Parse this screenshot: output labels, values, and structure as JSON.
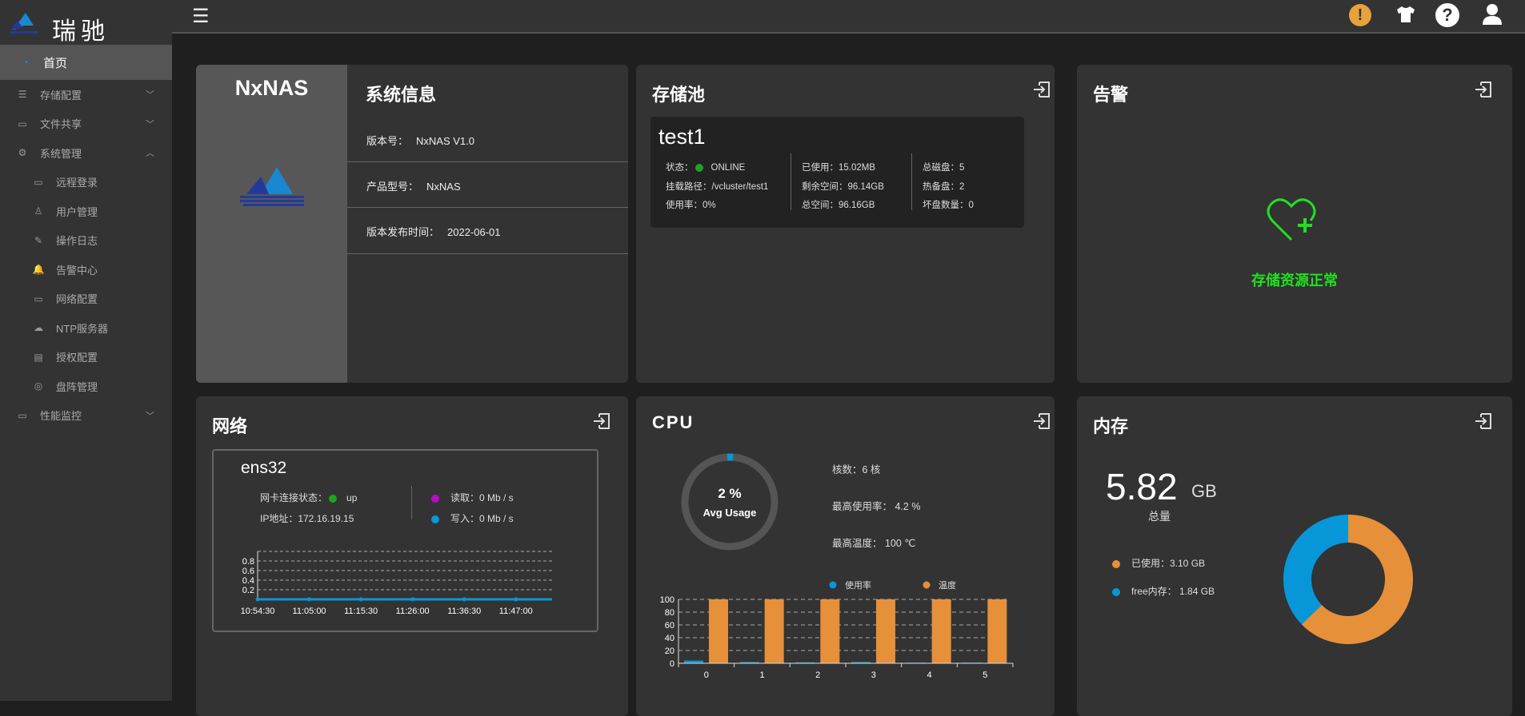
{
  "brand": {
    "name": "瑞驰"
  },
  "sidebar": {
    "items": [
      {
        "label": "首页",
        "icon": "dashboard-icon",
        "active": true
      },
      {
        "label": "存储配置",
        "icon": "server-icon",
        "expand": "down"
      },
      {
        "label": "文件共享",
        "icon": "folder-icon",
        "expand": "down"
      },
      {
        "label": "系统管理",
        "icon": "monitor-gear-icon",
        "expand": "up"
      },
      {
        "label": "远程登录",
        "icon": "monitor-icon",
        "sub": true
      },
      {
        "label": "用户管理",
        "icon": "user-icon",
        "sub": true
      },
      {
        "label": "操作日志",
        "icon": "edit-log-icon",
        "sub": true
      },
      {
        "label": "告警中心",
        "icon": "bell-icon",
        "sub": true
      },
      {
        "label": "网络配置",
        "icon": "network-icon",
        "sub": true
      },
      {
        "label": "NTP服务器",
        "icon": "cloud-icon",
        "sub": true
      },
      {
        "label": "授权配置",
        "icon": "license-icon",
        "sub": true
      },
      {
        "label": "盘阵管理",
        "icon": "disk-icon",
        "sub": true
      },
      {
        "label": "性能监控",
        "icon": "chart-icon",
        "expand": "down"
      }
    ]
  },
  "header": {
    "icons": [
      "alert-icon",
      "tshirt-icon",
      "help-icon",
      "user-icon"
    ]
  },
  "sysinfo": {
    "product": "NxNAS",
    "title": "系统信息",
    "rows": [
      {
        "label": "版本号：",
        "value": "NxNAS V1.0"
      },
      {
        "label": "产品型号：",
        "value": "NxNAS"
      },
      {
        "label": "版本发布时间：",
        "value": "2022-06-01"
      }
    ]
  },
  "pool": {
    "title": "存储池",
    "name": "test1",
    "status_label": "状态：",
    "status": "ONLINE",
    "mount": "挂载路径：/vcluster/test1",
    "usage": "使用率：0%",
    "used": "已使用：15.02MB",
    "free": "剩余空间：96.14GB",
    "total": "总空间：96.16GB",
    "disks": "总磁盘：5",
    "spare": "热备盘：2",
    "bad": "坏盘数量：0"
  },
  "alarm": {
    "title": "告警",
    "message": "存储资源正常"
  },
  "network": {
    "title": "网络",
    "iface": "ens32",
    "link_label": "网卡连接状态：",
    "link": "up",
    "ip": "IP地址：172.16.19.15",
    "read": "读取：0 Mb / s",
    "write": "写入：0 Mb / s"
  },
  "cpu": {
    "title": "CPU",
    "avg": "2 %",
    "avg_label": "Avg Usage",
    "avg_value": 2,
    "cores": "核数：6 核",
    "max_usage": "最高使用率： 4.2 %",
    "max_temp": "最高温度： 100 ℃"
  },
  "memory": {
    "title": "内存",
    "total": "5.82",
    "unit": "GB",
    "total_label": "总量",
    "used": "已使用：3.10 GB",
    "free": "free内存： 1.84 GB"
  },
  "colors": {
    "blue": "#0797d9",
    "orange": "#e6903a",
    "green": "#1fa21f",
    "purple": "#b40fc2",
    "alarm_green": "#21e021"
  },
  "chart_data": [
    {
      "type": "line",
      "title": "network",
      "x": [
        "10:54:30",
        "11:05:00",
        "11:15:30",
        "11:26:00",
        "11:36:30",
        "11:47:00"
      ],
      "yticks": [
        "0.2",
        "0.4",
        "0.6",
        "0.8"
      ],
      "ylim": [
        0,
        1
      ],
      "series": [
        {
          "name": "写入",
          "values": [
            0,
            0,
            0,
            0,
            0,
            0
          ]
        },
        {
          "name": "读取",
          "values": [
            0,
            0,
            0,
            0,
            0,
            0
          ]
        }
      ]
    },
    {
      "type": "bar",
      "title": "cpu",
      "categories": [
        "0",
        "1",
        "2",
        "3",
        "4",
        "5"
      ],
      "yticks": [
        "0",
        "20",
        "40",
        "60",
        "80",
        "100"
      ],
      "ylim": [
        0,
        100
      ],
      "series": [
        {
          "name": "使用率",
          "values": [
            4.2,
            2,
            1.5,
            2,
            1,
            1
          ]
        },
        {
          "name": "温度",
          "values": [
            100,
            100,
            100,
            100,
            100,
            100
          ]
        }
      ]
    },
    {
      "type": "pie",
      "title": "memory",
      "categories": [
        "已使用",
        "free内存"
      ],
      "values": [
        3.1,
        1.84
      ]
    }
  ]
}
